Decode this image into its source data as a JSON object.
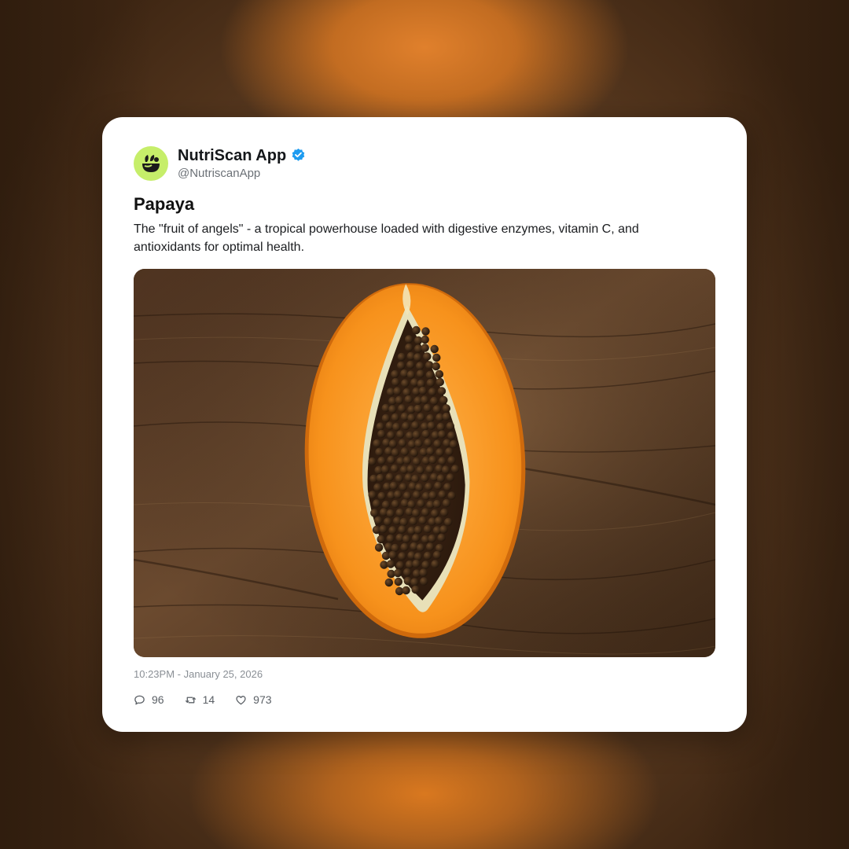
{
  "account": {
    "display_name": "NutriScan App",
    "handle": "@NutriscanApp",
    "verified": true,
    "avatar_icon": "leaf-bowl-logo-icon"
  },
  "post": {
    "title": "Papaya",
    "body": "The \"fruit of angels\" - a tropical powerhouse loaded with digestive enzymes, vitamin C, and antioxidants for optimal health.",
    "image_subject": "papaya-half-on-wood",
    "timestamp": "10:23PM - January 25, 2026"
  },
  "stats": {
    "replies": "96",
    "retweets": "14",
    "likes": "973"
  },
  "icons": {
    "reply": "comment-icon",
    "retweet": "retweet-icon",
    "like": "heart-icon",
    "verified": "verified-badge-icon"
  },
  "colors": {
    "verified": "#1d9bf0",
    "avatar_bg": "#c6ee6a",
    "papaya_flesh": "#f7931e",
    "wood": "#5a3b22"
  }
}
